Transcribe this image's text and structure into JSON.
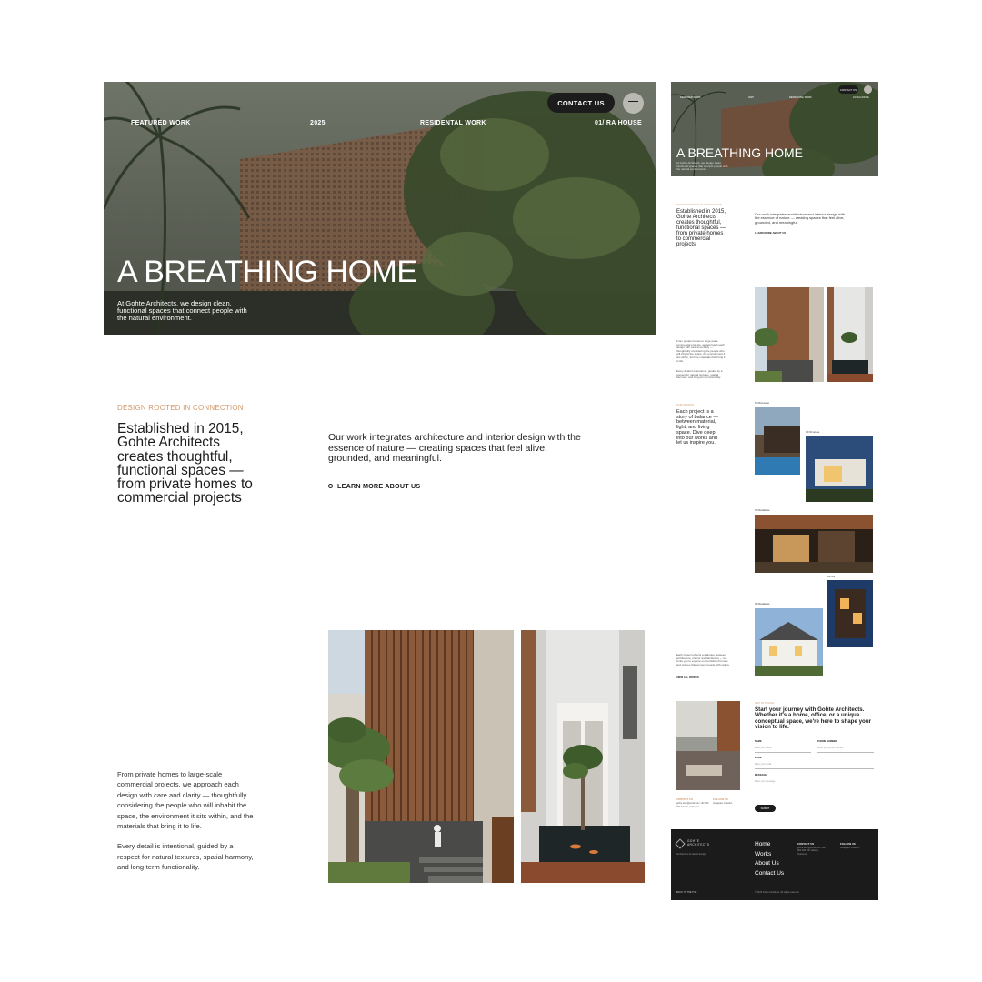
{
  "hero": {
    "nav": [
      "FEATURED WORK",
      "2025",
      "RESIDENTAL WORK",
      "01/ RA HOUSE"
    ],
    "contact_label": "CONTACT US",
    "title": "A BREATHING HOME",
    "subtitle": "At Gohte Architects, we design clean, functional spaces that connect people with the natural environment."
  },
  "about": {
    "eyebrow": "DESIGN ROOTED IN CONNECTION",
    "heading": "Established in 2015, Gohte Architects creates thoughtful, functional spaces — from private homes to commercial projects",
    "text": "Our work integrates architecture and interior design with the essence of nature — creating spaces that feel alive, grounded, and meaningful.",
    "learn_more": "LEARN MORE ABOUT US"
  },
  "body_copy": {
    "p1": "From private homes to large-scale commercial projects, we approach each design with care and clarity — thoughtfully considering the people who will inhabit the space, the environment it sits within, and the materials that bring it to life.",
    "p2": "Every detail is intentional, guided by a respect for natural textures, spatial harmony, and long-term functionality."
  },
  "mini": {
    "hero_title": "A BREATHING HOME",
    "nav": [
      "FEATURED WORK",
      "2025",
      "RESIDENTAL WORK",
      "01/ RA HOUSE"
    ],
    "contact_label": "CONTACT US",
    "hero_sub": "At Gohte Architects, we design clean, functional spaces that connect people with the natural environment.",
    "eyebrow": "DESIGN ROOTED IN CONNECTION",
    "heading": "Established in 2015, Gohte Architects creates thoughtful, functional spaces — from private homes to commercial projects",
    "about_text": "Our work integrates architecture and interior design with the essence of nature — creating spaces that feel alive, grounded, and meaningful.",
    "learn_more": "LEARN MORE ABOUT US",
    "body_p1": "From private homes to large-scale commercial projects, we approach each design with care and clarity — thoughtfully considering the people who will inhabit the space, the environment it sits within, and the materials that bring it to life.",
    "body_p2": "Every detail is intentional, guided by a respect for natural textures, spatial harmony, and long-term functionality.",
    "projects_eyebrow": "OUR WORKS",
    "projects_heading": "Each project is a story of balance — between material, light, and living space. Dive deep into our works and let us inspire you.",
    "captions": [
      "01/ RA House",
      "02/ ID House",
      "03/ Residence",
      "04/ GS",
      "05/ Residence"
    ],
    "projects_text": "Each project reflects a dialogue between architecture, interior and landscape — we invite you to explore our portfolio of homes and spaces that connect people with nature.",
    "view_all": "VIEW ALL WORKS",
    "form_eyebrow": "GET IN TOUCH",
    "form_heading": "Start your journey with Gohte Architects. Whether it's a home, office, or a unique conceptual space, we're here to shape your vision to life.",
    "labels": [
      "NAME",
      "PHONE NUMBER",
      "EMAIL",
      "MESSAGE"
    ],
    "placeholders": [
      "Enter your name",
      "Enter your phone number",
      "Enter your email",
      "Enter your message"
    ],
    "contact_h": "CONTACT US",
    "contact_t": "gohte.arch@email.com +62 000 000 Jakarta, Indonesia",
    "follow_h": "FOLLOW US",
    "follow_t": "Instagram LinkedIn",
    "submit": "SUBMIT",
    "footer_logo": "GOHTE ARCHITECTS",
    "footer_tag": "Architecture & interior design",
    "footer_nav": [
      "Home",
      "Works",
      "About Us",
      "Contact Us"
    ],
    "footer_contact_h": "CONTACT US",
    "footer_contact_t": "gohte.arch@email.com +62 000 000 000 Jakarta, Indonesia",
    "footer_follow_h": "FOLLOW US",
    "footer_follow_t": "Instagram LinkedIn",
    "footer_bottom": "BACK TO THE TOP",
    "footer_copy": "© 2025 Gohte Architects. All rights reserved."
  },
  "colors": {
    "accent": "#d1996a",
    "dark": "#1c1c1c",
    "footer": "#1b1b1b"
  },
  "icons": [
    "menu-icon",
    "learn-more-dot-icon",
    "logo-icon"
  ]
}
